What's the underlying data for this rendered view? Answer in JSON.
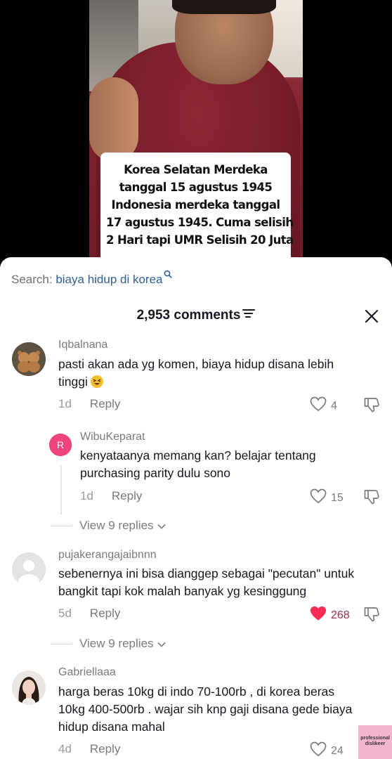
{
  "video": {
    "caption_lines": [
      "Korea Selatan Merdeka",
      "tanggal 15 agustus 1945",
      "Indonesia merdeka tanggal",
      "17 agustus 1945. Cuma selisih",
      "2 Hari tapi UMR Selisih 20 Juta"
    ]
  },
  "search": {
    "label": "Search:",
    "query": "biaya hidup di korea"
  },
  "header": {
    "comment_count": "2,953 comments"
  },
  "comments": [
    {
      "username": "Iqbalnana",
      "text_lines": [
        "pasti akan ada yg komen, biaya hidup disana lebih",
        "tinggi"
      ],
      "time": "1d",
      "reply_label": "Reply",
      "likes": "4",
      "liked": false
    },
    {
      "username": "WibuKeparat",
      "avatar_letter": "R",
      "text_lines": [
        "kenyataanya memang kan? belajar tentang",
        "purchasing parity dulu sono"
      ],
      "time": "1d",
      "reply_label": "Reply",
      "likes": "15",
      "liked": false
    },
    {
      "username": "pujakerangajaibnnn",
      "text_lines": [
        "sebenernya ini bisa dianggep sebagai \"pecutan\" untuk",
        "bangkit tapi kok malah banyak yg kesinggung"
      ],
      "time": "5d",
      "reply_label": "Reply",
      "likes": "268",
      "liked": true
    },
    {
      "username": "Gabriellaaa",
      "text_lines": [
        "harga beras 10kg di indo 70-100rb , di korea beras",
        "10kg 400-500rb . wajar sih knp gaji disana gede biaya",
        "hidup disana mahal"
      ],
      "time": "4d",
      "reply_label": "Reply",
      "likes": "24",
      "liked": false
    }
  ],
  "view_replies": [
    {
      "label": "View 9 replies"
    },
    {
      "label": "View 9 replies"
    }
  ],
  "watermark": {
    "line1": "professional",
    "line2": "dislikeer"
  },
  "colors": {
    "accent_link": "#2f5e93",
    "liked_heart": "#fe2c55",
    "avatar_letter_bg": "#f0457c"
  }
}
